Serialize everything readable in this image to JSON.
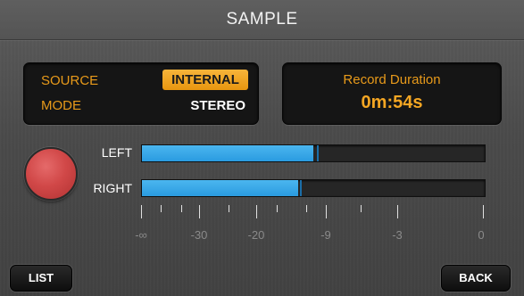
{
  "title": "SAMPLE",
  "settings": {
    "source_label": "SOURCE",
    "source_value": "INTERNAL",
    "mode_label": "MODE",
    "mode_value": "STEREO"
  },
  "duration": {
    "label": "Record Duration",
    "value": "0m:54s"
  },
  "meters": {
    "left": {
      "label": "LEFT",
      "level": 0.5,
      "peak": 0.51
    },
    "right": {
      "label": "RIGHT",
      "level": 0.455,
      "peak": 0.46
    }
  },
  "scale": {
    "labels": [
      "-∞",
      "-30",
      "-20",
      "-9",
      "-3",
      "0"
    ]
  },
  "buttons": {
    "list": "LIST",
    "back": "BACK"
  },
  "colors": {
    "accent": "#f4a623",
    "meter": "#2f9fe3",
    "record": "#d14848"
  }
}
